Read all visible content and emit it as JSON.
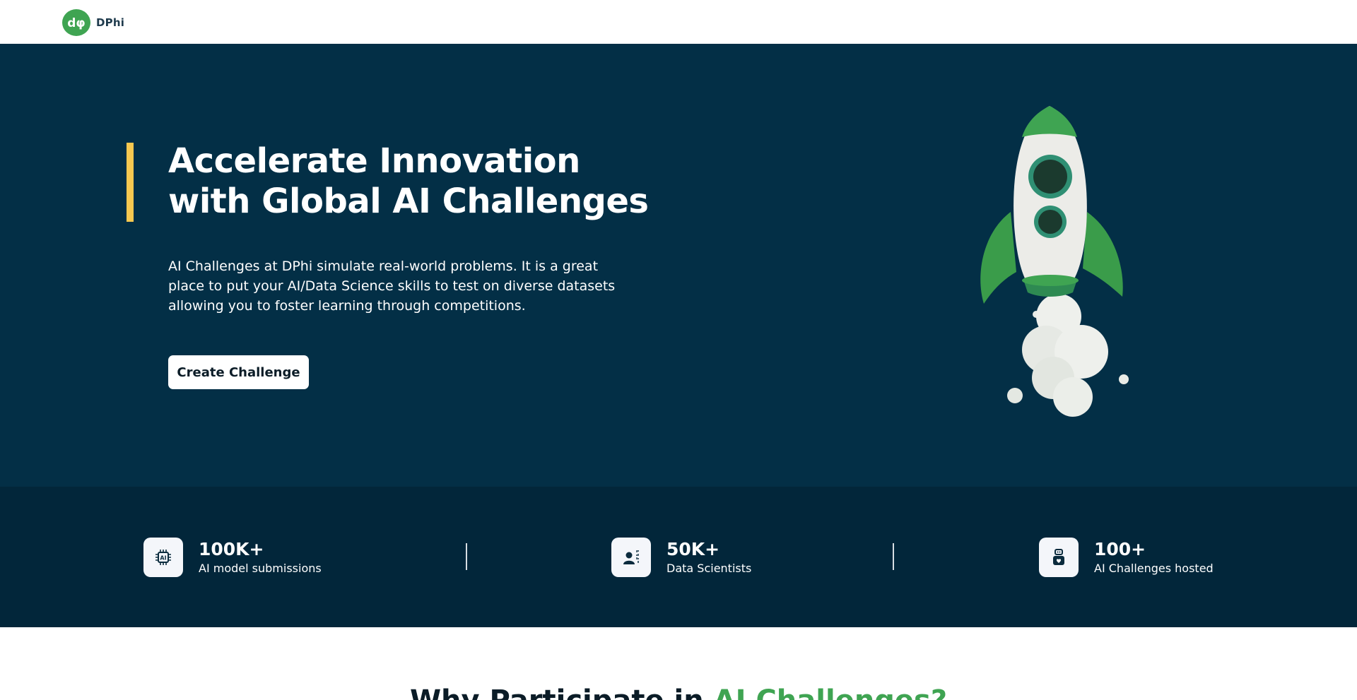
{
  "header": {
    "logo_text": "DPhi",
    "logo_mark": "dφ"
  },
  "hero": {
    "title": "Accelerate Innovation with Global AI Challenges",
    "description": "AI Challenges at DPhi simulate real-world problems. It is a great place to put your AI/Data Science skills to test on diverse datasets allowing you to foster learning through competitions.",
    "cta_label": "Create Challenge",
    "illustration": "rocket-illustration"
  },
  "stats": [
    {
      "icon": "ai-chip-icon",
      "value": "100K+",
      "label": "AI model submissions"
    },
    {
      "icon": "data-scientist-icon",
      "value": "50K+",
      "label": "Data Scientists"
    },
    {
      "icon": "robot-icon",
      "value": "100+",
      "label": "AI Challenges hosted"
    }
  ],
  "why_section": {
    "title_prefix": "Why Participate in ",
    "title_highlight": "AI Challenges?"
  },
  "colors": {
    "brand_green": "#3fa452",
    "hero_bg": "#032f46",
    "stats_bg": "#02263a",
    "accent_yellow": "#f7c850"
  }
}
